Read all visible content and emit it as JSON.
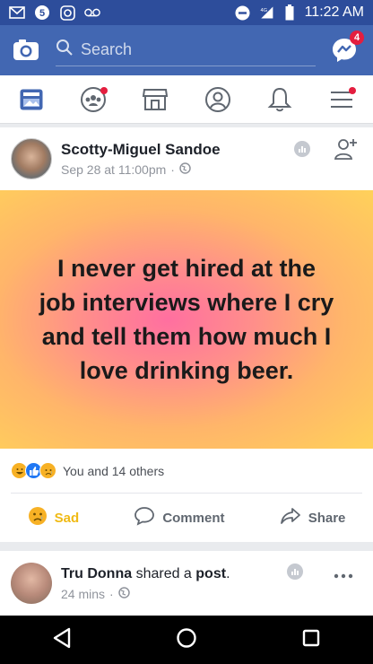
{
  "statusbar": {
    "time": "11:22 AM",
    "network": "4G",
    "icons": [
      "gmail-icon",
      "5-icon",
      "instagram-icon",
      "voicemail-icon",
      "dnd-icon",
      "signal-icon",
      "battery-icon"
    ]
  },
  "topbar": {
    "search_placeholder": "Search",
    "messenger_badge": "4"
  },
  "nav": {
    "items": [
      "news-feed-icon",
      "groups-icon",
      "marketplace-icon",
      "profile-icon",
      "notifications-icon",
      "menu-icon"
    ]
  },
  "post": {
    "author": "Scotty-Miguel Sandoe",
    "timestamp": "Sep 28 at 11:00pm",
    "separator": "·",
    "meme_text": "I never get hired at the job interviews where I cry and tell them how much I love drinking beer.",
    "reactions_text": "You and 14 others",
    "actions": {
      "sad": "Sad",
      "comment": "Comment",
      "share": "Share"
    },
    "colors": {
      "background_pink": "#ff6fa0",
      "background_yellow": "#ffd15a"
    }
  },
  "post2": {
    "author": "Tru Donna",
    "shared": "shared a",
    "post": "post",
    "period": ".",
    "timestamp": "24 mins",
    "separator": "·"
  },
  "colors": {
    "brand_blue": "#4267b2",
    "status_blue": "#2d4d9b",
    "badge_red": "#e41e3f"
  }
}
